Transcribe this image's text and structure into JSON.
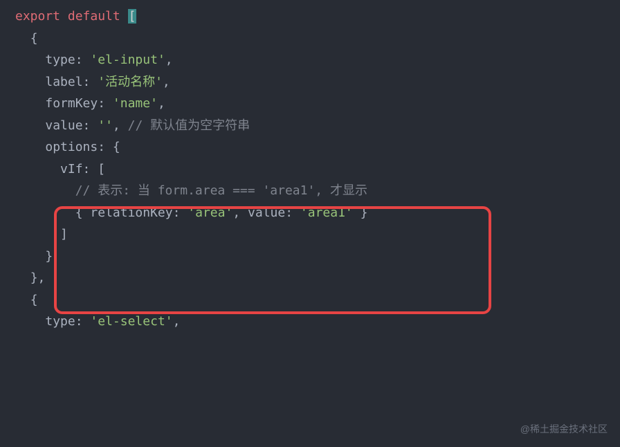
{
  "code": {
    "line1": {
      "export": "export",
      "default": "default",
      "bracket": "["
    },
    "line2": {
      "brace": "{"
    },
    "line3": {
      "prop": "type",
      "value": "'el-input'",
      "comma": ","
    },
    "line4": {
      "prop": "label",
      "value": "'活动名称'",
      "comma": ","
    },
    "line5": {
      "prop": "formKey",
      "value": "'name'",
      "comma": ","
    },
    "line6": {
      "prop": "value",
      "value": "''",
      "comma": ",",
      "comment": "// 默认值为空字符串"
    },
    "line7": {
      "prop": "options",
      "brace": "{"
    },
    "line8": {
      "prop": "vIf",
      "bracket": "["
    },
    "line9": {
      "comment": "// 表示: 当 form.area === 'area1', 才显示"
    },
    "line10": {
      "brace_open": "{",
      "prop1": "relationKey",
      "value1": "'area'",
      "comma1": ",",
      "prop2": "value",
      "value2": "'area1'",
      "brace_close": "}"
    },
    "line11": {
      "bracket": "]"
    },
    "line12": {
      "brace": "}"
    },
    "line13": {
      "brace": "}",
      "comma": ","
    },
    "line14": {
      "brace": "{"
    },
    "line15": {
      "prop": "type",
      "value": "'el-select'",
      "comma": ","
    }
  },
  "watermark": "@稀土掘金技术社区"
}
